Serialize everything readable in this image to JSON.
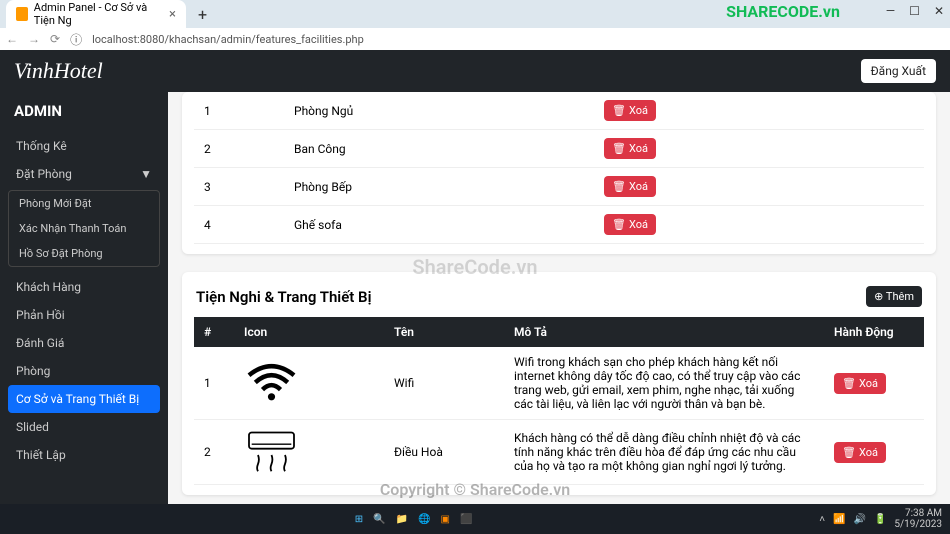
{
  "browser": {
    "tab_title": "Admin Panel - Cơ Sở và Tiện Ng",
    "url": "localhost:8080/khachsan/admin/features_facilities.php"
  },
  "header": {
    "brand": "VinhHotel",
    "logout": "Đăng Xuất"
  },
  "sidebar": {
    "title": "ADMIN",
    "items": [
      {
        "label": "Thống Kê"
      },
      {
        "label": "Đặt Phòng",
        "expanded": true,
        "children": [
          {
            "label": "Phòng Mới Đặt"
          },
          {
            "label": "Xác Nhận Thanh Toán"
          },
          {
            "label": "Hồ Sơ Đặt Phòng"
          }
        ]
      },
      {
        "label": "Khách Hàng"
      },
      {
        "label": "Phản Hồi"
      },
      {
        "label": "Đánh Giá"
      },
      {
        "label": "Phòng"
      },
      {
        "label": "Cơ Sở và Trang Thiết Bị",
        "active": true
      },
      {
        "label": "Slided"
      },
      {
        "label": "Thiết Lập"
      }
    ]
  },
  "features": {
    "rows": [
      {
        "num": "1",
        "name": "Phòng Ngủ"
      },
      {
        "num": "2",
        "name": "Ban Công"
      },
      {
        "num": "3",
        "name": "Phòng Bếp"
      },
      {
        "num": "4",
        "name": "Ghế sofa"
      }
    ],
    "delete_label": "Xoá"
  },
  "facilities": {
    "title": "Tiện Nghi & Trang Thiết Bị",
    "add_label": "Thêm",
    "headers": {
      "num": "#",
      "icon": "Icon",
      "name": "Tên",
      "desc": "Mô Tả",
      "action": "Hành Động"
    },
    "rows": [
      {
        "num": "1",
        "name": "Wifi",
        "desc": "Wifi trong khách sạn cho phép khách hàng kết nối internet không dây tốc độ cao, có thể truy cập vào các trang web, gửi email, xem phim, nghe nhạc, tải xuống các tài liệu, và liên lạc với người thân và bạn bè."
      },
      {
        "num": "2",
        "name": "Điều Hoà",
        "desc": "Khách hàng có thể dễ dàng điều chỉnh nhiệt độ và các tính năng khác trên điều hòa để đáp ứng các nhu cầu của họ và tạo ra một không gian nghỉ ngơi lý tưởng."
      }
    ],
    "delete_label": "Xoá"
  },
  "taskbar": {
    "time": "7:38 AM",
    "date": "5/19/2023"
  },
  "watermark": {
    "logo": "SHARECODE.vn",
    "center": "ShareCode.vn",
    "bottom": "Copyright © ShareCode.vn"
  }
}
